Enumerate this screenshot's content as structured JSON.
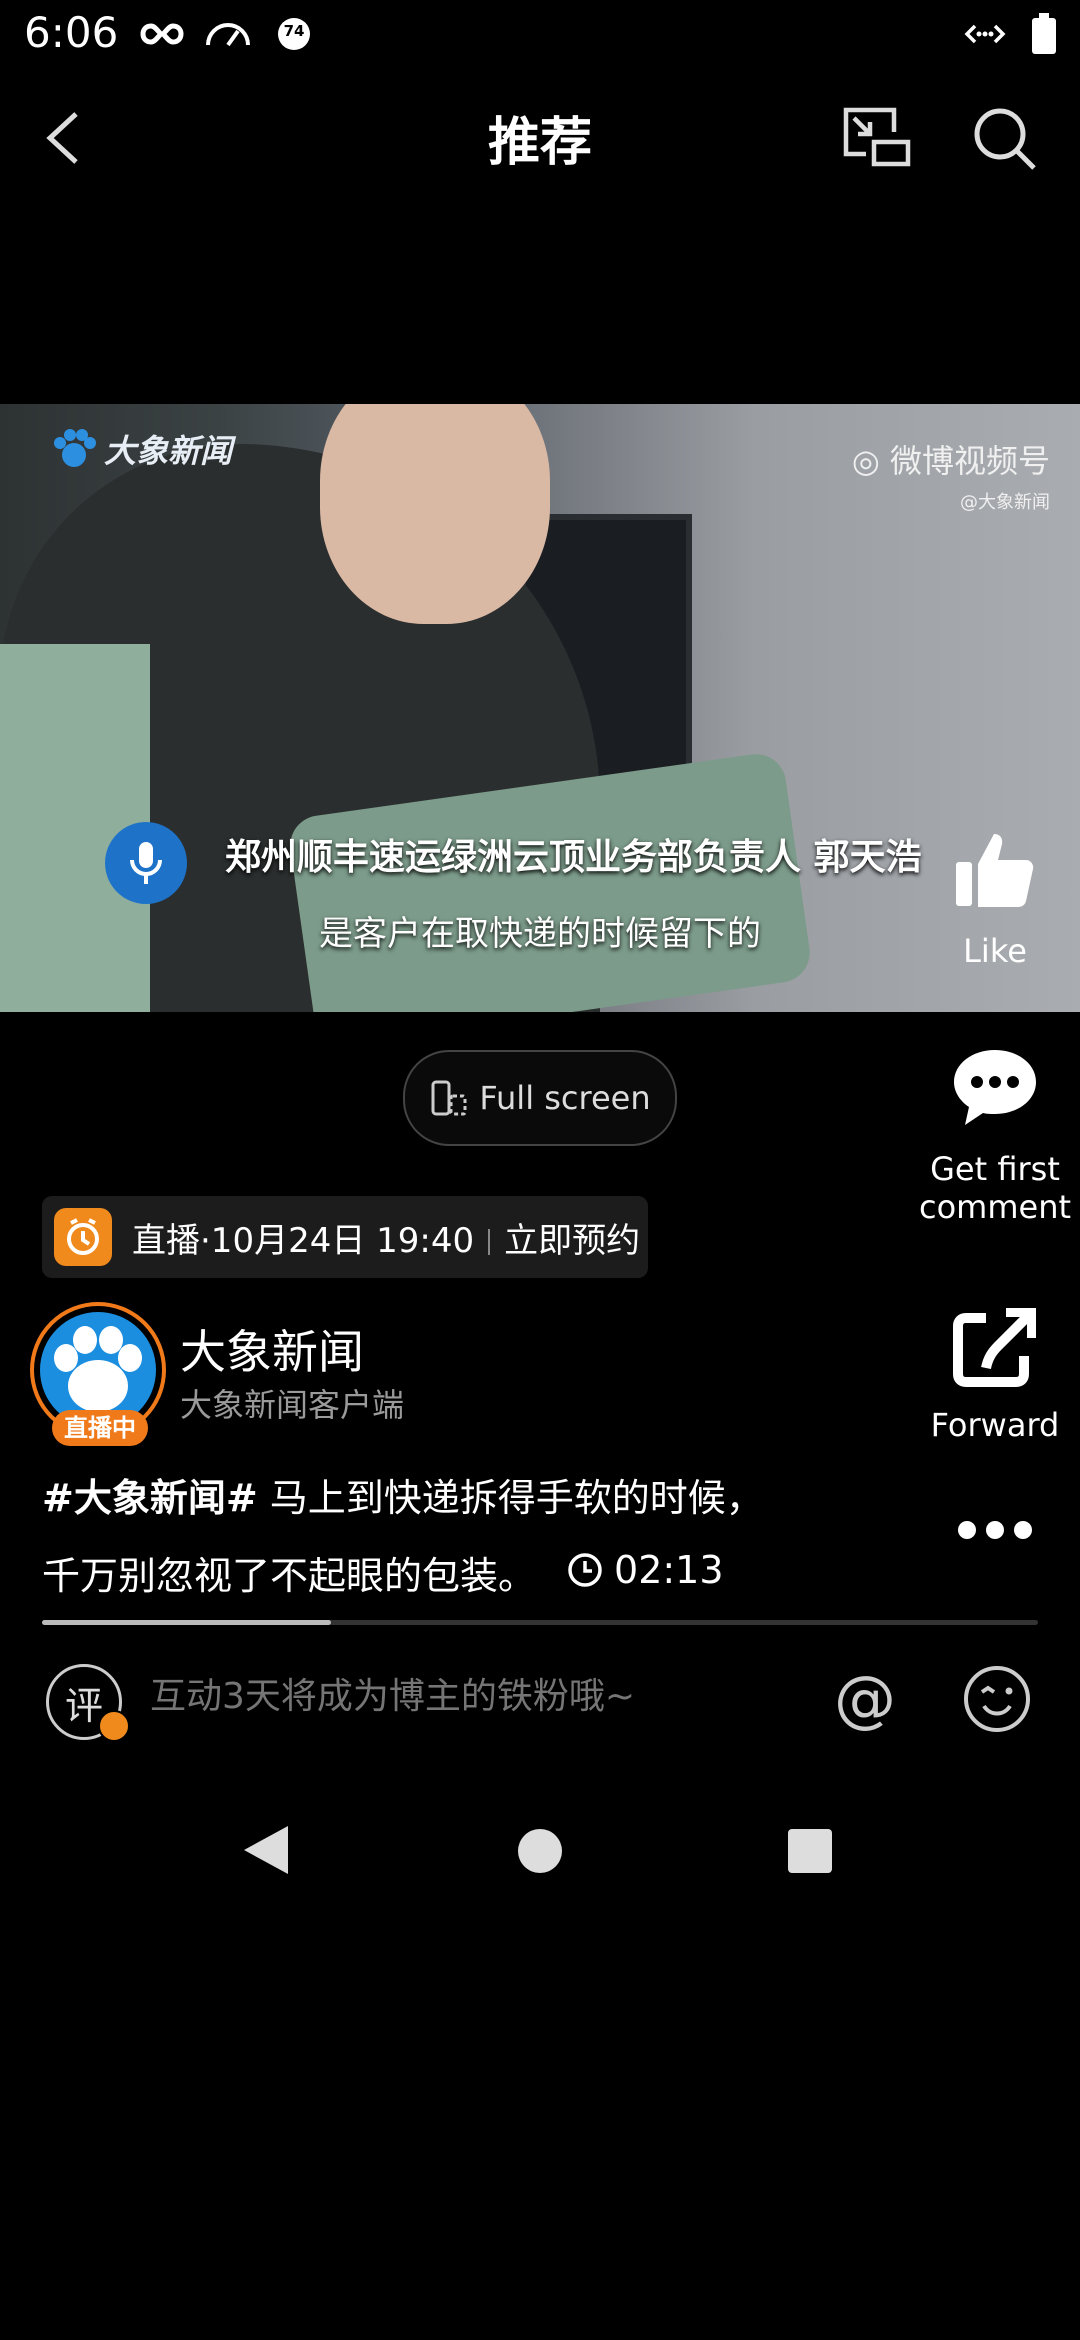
{
  "status_bar": {
    "time": "6:06",
    "badge_number": "74"
  },
  "top_bar": {
    "title": "推荐"
  },
  "video": {
    "watermark_left": "大象新闻",
    "watermark_right_line1": "微博视频号",
    "watermark_right_line2": "@大象新闻",
    "subtitle_line1": "郑州顺丰速运绿洲云顶业务部负责人 郭天浩",
    "subtitle_line2": "是客户在取快递的时候留下的"
  },
  "actions": {
    "like_label": "Like",
    "comment_label": "Get first comment",
    "forward_label": "Forward",
    "fullscreen_label": "Full screen"
  },
  "live_reminder": {
    "text": "直播·10月24日 19:40",
    "action": "立即预约"
  },
  "account": {
    "name": "大象新闻",
    "subtitle": "大象新闻客户端",
    "live_badge": "直播中"
  },
  "post": {
    "hashtag": "#大象新闻#",
    "text_line1": " 马上到快递拆得手软的时候，",
    "text_line2": "千万别忽视了不起眼的包装。",
    "duration": "02:13",
    "progress": 0.29
  },
  "comment_bar": {
    "icon_text": "评",
    "placeholder": "互动3天将成为博主的铁粉哦~"
  },
  "colors": {
    "accent_orange": "#f08a1c",
    "brand_blue": "#1b8ee0",
    "background": "#000000"
  }
}
